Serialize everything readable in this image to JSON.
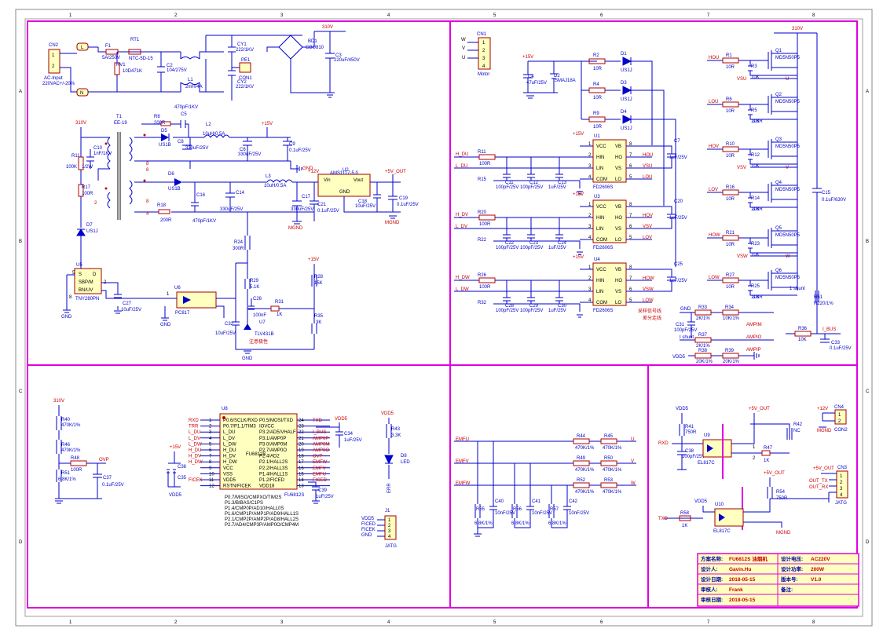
{
  "frame": {
    "col_labels": [
      "1",
      "2",
      "3",
      "4",
      "5",
      "6",
      "7",
      "8"
    ],
    "row_labels": [
      "A",
      "B",
      "C",
      "D"
    ]
  },
  "power": {
    "cn2": "CN2",
    "ac_input": "AC-Input",
    "ac_spec": "220VAC+/-20%",
    "f1": "F1",
    "f1_val": "5A/250V",
    "rt1": "RT1",
    "rt1_val": "NTC-5D-15",
    "rv1": "RV1",
    "rv1_val": "10D471K",
    "c2": "C2",
    "c2_val": "104/275V",
    "l1": "L1",
    "l1_val": "2mH/4A",
    "cy1": "CY1",
    "cy1_val": "222/1KV",
    "cy2": "CY2",
    "cy2_val": "222/1KV",
    "pe1": "PE1",
    "con1": "CON1",
    "bd1": "BD1",
    "bd1_val": "GBU810",
    "c3": "C3",
    "c3_val": "220uF/450V",
    "v310": "310V",
    "net_l": "L",
    "net_n": "N"
  },
  "flyback": {
    "t1": "T1",
    "t1_type": "EE-19",
    "r8": "R8",
    "r8_val": "200R",
    "c5": "C5",
    "c5_val": "470pF/1KV",
    "d5": "D5",
    "d5_val": "US1B",
    "c8": "C8",
    "c8_val": "330uF/25V",
    "l2": "L2",
    "l2_val": "10uH/0.5A",
    "c6": "C6",
    "c6_val": "330uF/25V",
    "c9": "C9",
    "c9_val": "0.1uF/25V",
    "v15": "+15V",
    "v12": "+12V",
    "r11": "R11",
    "r11_val": "100K",
    "r11_pw": "1/2W",
    "c10": "C10",
    "c10_val": "1nF/1KV",
    "r17": "R17",
    "r17_val": "100R",
    "d7": "D7",
    "d7_val": "US1J",
    "d6": "D6",
    "d6_val": "US1B",
    "r18": "R18",
    "r18_val": "200R",
    "c16": "C16",
    "c16_val": "470pF/1KV",
    "c14": "C14",
    "c14_val": "330uF/25V",
    "l3": "L3",
    "l3_val": "10uH/0.5A",
    "u2": "U2",
    "u2_val": "AMS1117-5.0",
    "vin": "Vin",
    "vout": "Vout",
    "gnd": "GND",
    "c17": "C17",
    "c17_val": "330uF/25V",
    "c21": "C21",
    "c21_val": "0.1uF/25V",
    "c18": "C18",
    "c18_val": "10uF/25V",
    "c19": "C19",
    "c19_val": "0.1uF/25V",
    "v5out": "+5V_OUT",
    "mgnd": "MGND",
    "u5": "U5",
    "u5_val": "TNY280PN",
    "u5_s": "S",
    "u5_d": "D",
    "u5_bp": "SBP/M",
    "u5_en": "BN/UV",
    "c27": "C27",
    "c27_val": "10uF/25V",
    "u6": "U6",
    "u6_val": "PC817",
    "r24": "R24",
    "r24_val": "300R",
    "r29": "R29",
    "r29_val": "5.1K",
    "c26": "C26",
    "c26_val": "100nF",
    "r31": "R31",
    "r31_val": "1K",
    "c32": "C32",
    "c32_val": "10uF/25V",
    "u7": "U7",
    "u7_val": "TLV431B",
    "r28": "R28",
    "r28_val": "15K",
    "r35": "R35",
    "r35_val": "3K",
    "note": "注意极性",
    "pin_5": "5",
    "pin_8": "8",
    "pin_2": "2",
    "pin_1": "1"
  },
  "motor": {
    "cn1": "CN1",
    "label": "Motor",
    "pins": [
      "W",
      "V",
      "U",
      "1",
      "2",
      "3",
      "4"
    ],
    "v15": "+15V",
    "c4": "C4",
    "c4_val": "47uF/25V",
    "d2": "D2",
    "d2_val": "SMAJ18A",
    "r2": "R2",
    "r2_val": "10R",
    "r4": "R4",
    "r4_val": "10R",
    "r9": "R9",
    "r9_val": "10R",
    "d1": "D1",
    "d3": "D3",
    "d4": "D4",
    "dval": "US1J"
  },
  "drivers": [
    {
      "u": "U1",
      "val": "FD2606S",
      "hin": "H_DU",
      "lin": "L_DU",
      "ra": "R11",
      "rb": "R15",
      "rval": "100R",
      "ca": "C11",
      "cb": "C12",
      "cc": "C13",
      "cav": "100pF/25V",
      "ccv": "1uF/25V",
      "cout": "C7",
      "coutv": "1uF/25V",
      "ho": "HOU",
      "vs": "VSU",
      "lo": "LOU"
    },
    {
      "u": "U3",
      "val": "FD2606S",
      "hin": "H_DV",
      "lin": "L_DV",
      "ra": "R20",
      "rb": "R22",
      "rval": "100R",
      "ca": "C22",
      "cb": "C23",
      "cc": "C24",
      "cav": "100pF/25V",
      "ccv": "1uF/25V",
      "cout": "C20",
      "coutv": "1uF/25V",
      "ho": "HOV",
      "vs": "VSV",
      "lo": "LOV"
    },
    {
      "u": "U4",
      "val": "FD2606S",
      "hin": "H_DW",
      "lin": "L_DW",
      "ra": "R26",
      "rb": "R32",
      "rval": "100R",
      "ca": "C28",
      "cb": "C29",
      "cc": "C30",
      "cav": "100pF/25V",
      "ccv": "1uF/25V",
      "cout": "C25",
      "coutv": "1uF/25V",
      "ho": "HOW",
      "vs": "VSW",
      "lo": "LOW"
    }
  ],
  "driver_pins": {
    "vcc": "VCC",
    "hin": "HIN",
    "lin": "LIN",
    "com": "COM",
    "vb": "VB",
    "ho": "HO",
    "vs": "VS",
    "lo": "LO"
  },
  "mosfets": {
    "v310": "310V",
    "part": "MD5N50P5",
    "rows": [
      {
        "gate": "HOU",
        "r": "R1",
        "rv": "10R",
        "rd": "R3",
        "q": "Q1",
        "src": "VSU",
        "out": "U"
      },
      {
        "gate": "LOU",
        "r": "R6",
        "rv": "10R",
        "rd": "R5",
        "q": "Q2",
        "src": "",
        "out": ""
      },
      {
        "gate": "HOV",
        "r": "R10",
        "rv": "10R",
        "rd": "R12",
        "q": "Q3",
        "src": "VSV",
        "out": "V"
      },
      {
        "gate": "LOV",
        "r": "R16",
        "rv": "10R",
        "rd": "R14",
        "q": "Q4",
        "src": "",
        "out": ""
      },
      {
        "gate": "HOW",
        "r": "R21",
        "rv": "10R",
        "rd": "R23",
        "q": "Q5",
        "src": "VSW",
        "out": "W"
      },
      {
        "gate": "LOW",
        "r": "R27",
        "rv": "10R",
        "rd": "R25",
        "q": "Q6",
        "src": "",
        "out": ""
      }
    ],
    "shunt_r": "3.3R",
    "rd_val": "10K",
    "c15": "C15",
    "c15_val": "0.1uF/630V",
    "r51": "R51",
    "r51_val": "R220/1%",
    "shunt": "1 shunt"
  },
  "sense": {
    "gnd": "GND",
    "note1": "采样信号线",
    "note2": "差分走线",
    "r33": "R33",
    "r33_val": "2K/1%",
    "r34": "R34",
    "r34_val": "10K/1%",
    "c31": "C31",
    "c31_val": "100pF/25V",
    "r37": "R37",
    "r37_val": "2K/1%",
    "r38": "R38",
    "r38_val": "20K/1%",
    "r39": "R39",
    "r39_val": "20K/1%",
    "r36": "R36",
    "r36_val": "10K",
    "c33": "C33",
    "c33_val": "0.1uF/25V",
    "ampim": "AMPIM",
    "ampio": "AMPIO",
    "ampip": "AMPIP",
    "shunt": "I shunt",
    "vdd5": "VDD5",
    "ibus": "I_BUS"
  },
  "mcu": {
    "v310": "310V",
    "r40": "R40",
    "r40_val": "470K/1%",
    "r46": "R46",
    "r46_val": "470K/1%",
    "r48": "R48",
    "r48_val": "100R",
    "r51": "R51",
    "r51_val": "6.8K/1%",
    "c37": "C37",
    "c37_val": "0.1uF/25V",
    "ovp": "OVP",
    "u8": "U8",
    "u8_val": "FU6812S",
    "v15": "+15V",
    "vdd5": "VDD5",
    "c34": "C34",
    "c34_val": "1uF/25V",
    "c36": "C36",
    "c35": "C35",
    "c39": "C39",
    "c39_val": "1uF/25V",
    "left_nets": [
      "RXD",
      "TRR",
      "L_DU",
      "L_DV",
      "L_DW",
      "H_DU",
      "H_DV",
      "H_DW",
      "",
      "",
      "FICEK",
      ""
    ],
    "left_pins": [
      "P0.6/SCLK/RXD",
      "P0.7/P1.1/TIM3",
      "L_DU",
      "L_DV",
      "L_DW",
      "H_DU",
      "H_DV",
      "H_DW",
      "VCC",
      "VSS",
      "VDD5",
      "RSTN/FICEK"
    ],
    "left_nums": [
      "1",
      "2",
      "3",
      "4",
      "5",
      "6",
      "7",
      "8",
      "9",
      "10",
      "11",
      "12"
    ],
    "right_pins": [
      "P0.5/MOSI/TXD",
      "IOVCC",
      "P3.2/AD5/VHALF",
      "P3.1/AMP0P",
      "P3.0/AMP0M",
      "P2.7/AMP0O",
      "P2.4/AD2",
      "P2.1/HALL2S",
      "P2.2/HALL3S",
      "P1.4/HALL1S",
      "P1.2/FICED",
      "VDD18"
    ],
    "right_nums": [
      "24",
      "23",
      "22",
      "21",
      "20",
      "19",
      "18",
      "17",
      "16",
      "15",
      "14",
      "13"
    ],
    "right_nets": [
      "TXD",
      "",
      "I_BUS",
      "AMP0P",
      "AMP0M",
      "AMP0O",
      "OVP",
      "EMFW",
      "EMFV",
      "EMFU",
      "FICED",
      ""
    ],
    "footnotes": [
      "P0.7/MISO/CMPXO/TIM2S",
      "P1.3/BIBAS/C1PS",
      "P1.4/CMP0P/AD10/HALL0S",
      "P1.6/CMP1P/AMP1P/AD9/HALL1S",
      "P2.1/CMP2P/AMP2P/AD8/HALL2S",
      "P2.7/AD4/CMP3P/AMP0O/CMP4M"
    ],
    "r43": "R43",
    "r43_val": "3.3K",
    "d8": "D8",
    "d8_val": "LED",
    "err": "ERR",
    "j1": "J1",
    "j1_nets": [
      "VDD5",
      "FICED",
      "FICEK",
      "GND"
    ],
    "j1_nums": [
      "1",
      "2",
      "3",
      "4"
    ],
    "j1_label": "JATG"
  },
  "bemf": {
    "rows": [
      {
        "net": "EMFU",
        "ra": "R44",
        "rb": "R45",
        "out": "U"
      },
      {
        "net": "EMFV",
        "ra": "R49",
        "rb": "R50",
        "out": "V"
      },
      {
        "net": "EMFW",
        "ra": "R52",
        "rb": "R53",
        "out": "W"
      }
    ],
    "r_val": "470K/1%",
    "low": [
      {
        "r": "R55",
        "c": "C40"
      },
      {
        "r": "R56",
        "c": "C41"
      },
      {
        "r": "R57",
        "c": "C42"
      }
    ],
    "low_r_val": "6.8K/1%",
    "c_val": "10nF/25V"
  },
  "comm": {
    "vdd5": "VDD5",
    "v5out": "+5V_OUT",
    "v12": "+12V",
    "mgnd": "MGND",
    "r41": "R41",
    "r41_val": "750R",
    "rxd": "RXD",
    "c38": "C38",
    "c38_val": "100pF/25V",
    "u9": "U9",
    "u9_val": "EL817C",
    "r42": "R42",
    "r42_val": "NC",
    "r47": "R47",
    "r47_val": "1K",
    "cn4": "CN4",
    "cn4_val": "CON2",
    "cn4_nums": [
      "1",
      "2"
    ],
    "cn3": "CN3",
    "cn3_val": "JATG",
    "cn3_nums": [
      "1",
      "2",
      "3",
      "4"
    ],
    "out_tx": "OUT_TX",
    "out_rx": "OUT_RX",
    "r54": "R54",
    "r54_val": "750R",
    "u10": "U10",
    "u10_val": "EL817C",
    "txd": "TXD",
    "r58": "R58",
    "r58_val": "1K"
  },
  "titleblock": {
    "scheme_label": "方案名称:",
    "scheme_val": "FU6812S 油烟机",
    "voltage_label": "设计电压:",
    "voltage_val": "AC220V",
    "designer_label": "设计人:",
    "designer_val": "Gavin.Hu",
    "power_label": "设计功率:",
    "power_val": "200W",
    "date_label": "设计日期:",
    "date_val": "2018-05-15",
    "version_label": "版本号:",
    "version_val": "V1.0",
    "reviewer_label": "审核人:",
    "reviewer_val": "Frank",
    "rdate_label": "审核日期:",
    "rdate_val": "2018-05-15",
    "remark_label": "备注:"
  }
}
